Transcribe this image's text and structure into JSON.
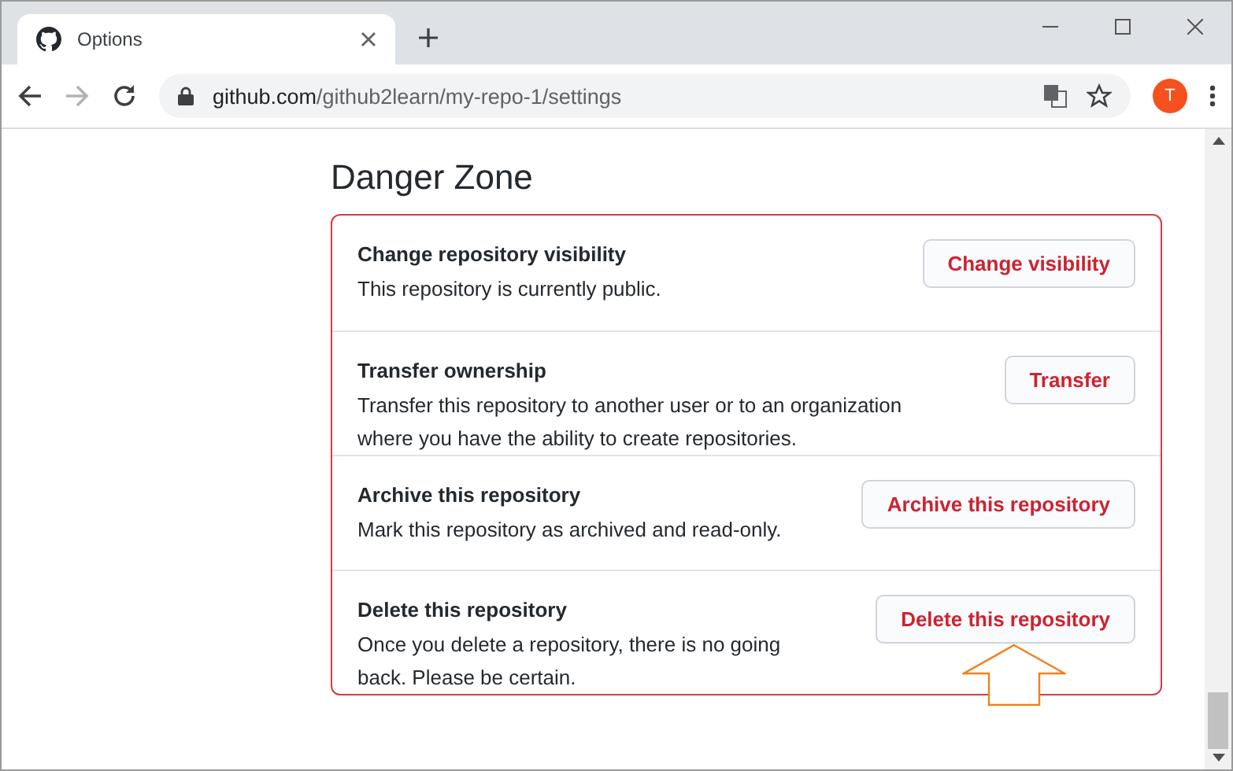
{
  "browser": {
    "tab_title": "Options",
    "url_host": "github.com",
    "url_path": "/github2learn/my-repo-1/settings",
    "profile_initial": "T"
  },
  "heading": "Danger Zone",
  "rows": [
    {
      "title": "Change repository visibility",
      "description": [
        "This repository is currently public."
      ],
      "button": "Change visibility",
      "highlighted": false
    },
    {
      "title": "Transfer ownership",
      "description": [
        "Transfer this repository to another user or to an organization",
        "where you have the ability to create repositories."
      ],
      "button": "Transfer",
      "highlighted": false
    },
    {
      "title": "Archive this repository",
      "description": [
        "Mark this repository as archived and read-only."
      ],
      "button": "Archive this repository",
      "highlighted": false
    },
    {
      "title": "Delete this repository",
      "description": [
        "Once you delete a repository, there is no going",
        "back. Please be certain."
      ],
      "button": "Delete this repository",
      "highlighted": true
    }
  ]
}
